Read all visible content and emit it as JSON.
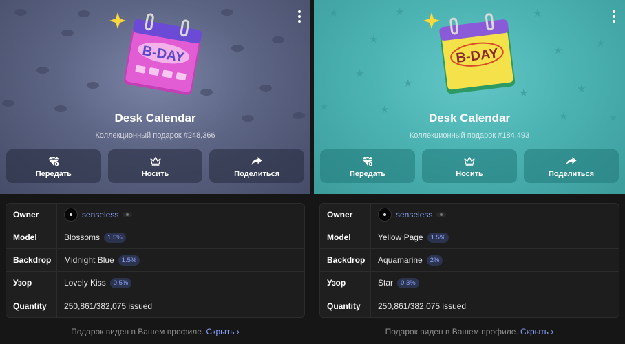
{
  "gifts": [
    {
      "title": "Desk Calendar",
      "subtitle": "Коллекционный подарок #248,366",
      "calendar_text": "B-DAY",
      "actions": [
        {
          "label": "Передать",
          "icon": "transfer-icon"
        },
        {
          "label": "Носить",
          "icon": "crown-icon"
        },
        {
          "label": "Поделиться",
          "icon": "share-icon"
        }
      ],
      "details": {
        "owner_label": "Owner",
        "owner_name": "senseless",
        "model_label": "Model",
        "model_value": "Blossoms",
        "model_rarity": "1.5%",
        "backdrop_label": "Backdrop",
        "backdrop_value": "Midnight Blue",
        "backdrop_rarity": "1.5%",
        "pattern_label": "Узор",
        "pattern_value": "Lovely Kiss",
        "pattern_rarity": "0.5%",
        "quantity_label": "Quantity",
        "quantity_value": "250,861/382,075 issued"
      },
      "footer_text": "Подарок виден в Вашем профиле.",
      "footer_link": "Скрыть ›",
      "colors": {
        "backdrop": "#5d6585",
        "calendar": "#e25cd4"
      }
    },
    {
      "title": "Desk Calendar",
      "subtitle": "Коллекционный подарок #184,493",
      "calendar_text": "B-DAY",
      "actions": [
        {
          "label": "Передать",
          "icon": "transfer-icon"
        },
        {
          "label": "Носить",
          "icon": "crown-icon"
        },
        {
          "label": "Поделиться",
          "icon": "share-icon"
        }
      ],
      "details": {
        "owner_label": "Owner",
        "owner_name": "senseless",
        "model_label": "Model",
        "model_value": "Yellow Page",
        "model_rarity": "1.5%",
        "backdrop_label": "Backdrop",
        "backdrop_value": "Aquamarine",
        "backdrop_rarity": "2%",
        "pattern_label": "Узор",
        "pattern_value": "Star",
        "pattern_rarity": "0.3%",
        "quantity_label": "Quantity",
        "quantity_value": "250,861/382,075 issued"
      },
      "footer_text": "Подарок виден в Вашем профиле.",
      "footer_link": "Скрыть ›",
      "colors": {
        "backdrop": "#4cb3b3",
        "calendar": "#f5e24a"
      }
    }
  ]
}
